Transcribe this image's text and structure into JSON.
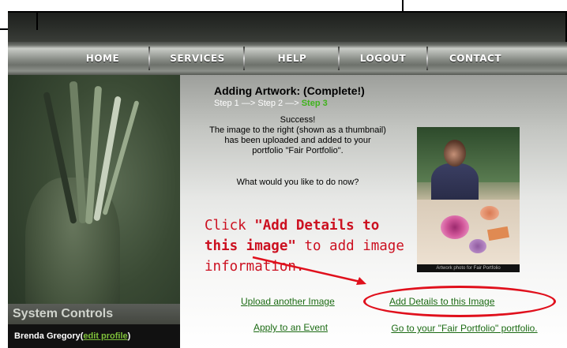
{
  "nav": {
    "items": [
      "HOME",
      "SERVICES",
      "HELP",
      "LOGOUT",
      "CONTACT"
    ]
  },
  "sidebar": {
    "section_title": "System Controls",
    "user_name": "Brenda Gregory",
    "user_name_suffix": " (",
    "edit_profile": "edit profile",
    "user_name_close": ")"
  },
  "content": {
    "title": "Adding Artwork: (Complete!)",
    "steps": {
      "step1": "Step 1",
      "arrow1": " —> ",
      "step2": "Step 2",
      "arrow2": " —> ",
      "step3": "Step 3"
    },
    "success_heading": "Success!",
    "success_message": "The image to the right (shown as a thumbnail) has been uploaded and added to your portfolio \"Fair Portfolio\".",
    "question": "What would you like to do now?",
    "links": {
      "upload_another": "Upload another Image",
      "add_details": "Add Details to this Image",
      "apply_event": "Apply to an Event",
      "go_portfolio": "Go to your \"Fair Portfolio\" portfolio."
    },
    "annotation": {
      "prefix": "Click ",
      "bold": "\"Add Details to\nthis image\"",
      "suffix": " to add image\ninformation."
    },
    "thumbnail_caption": "Artwork photo for Fair Portfolio"
  },
  "colors": {
    "link": "#1c6b14",
    "annotation": "#cc1020",
    "current_step": "#3fb31b",
    "profile_link": "#7fc13a"
  }
}
